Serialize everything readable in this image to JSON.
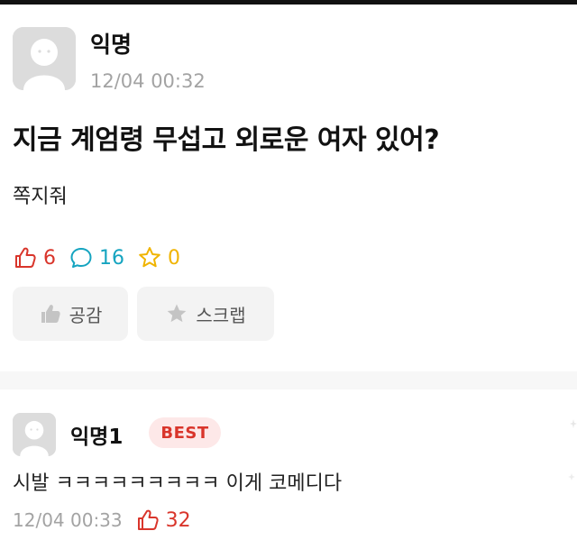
{
  "post": {
    "author": "익명",
    "time": "12/04 00:32",
    "title": "지금 계엄령 무섭고 외로운 여자 있어?",
    "body": "쪽지줘",
    "stats": {
      "likes": "6",
      "comments": "16",
      "scraps": "0"
    },
    "actions": {
      "like_label": "공감",
      "scrap_label": "스크랩"
    }
  },
  "comment": {
    "author": "익명1",
    "badge": "BEST",
    "body": "시발 ㅋㅋㅋㅋㅋㅋㅋㅋㅋ 이게 코메디다",
    "time": "12/04 00:33",
    "likes": "32"
  },
  "colors": {
    "like_red": "#d9352b",
    "comment_teal": "#15a4c0",
    "scrap_yellow": "#f0b400",
    "muted_gray": "#a3a3a3"
  }
}
